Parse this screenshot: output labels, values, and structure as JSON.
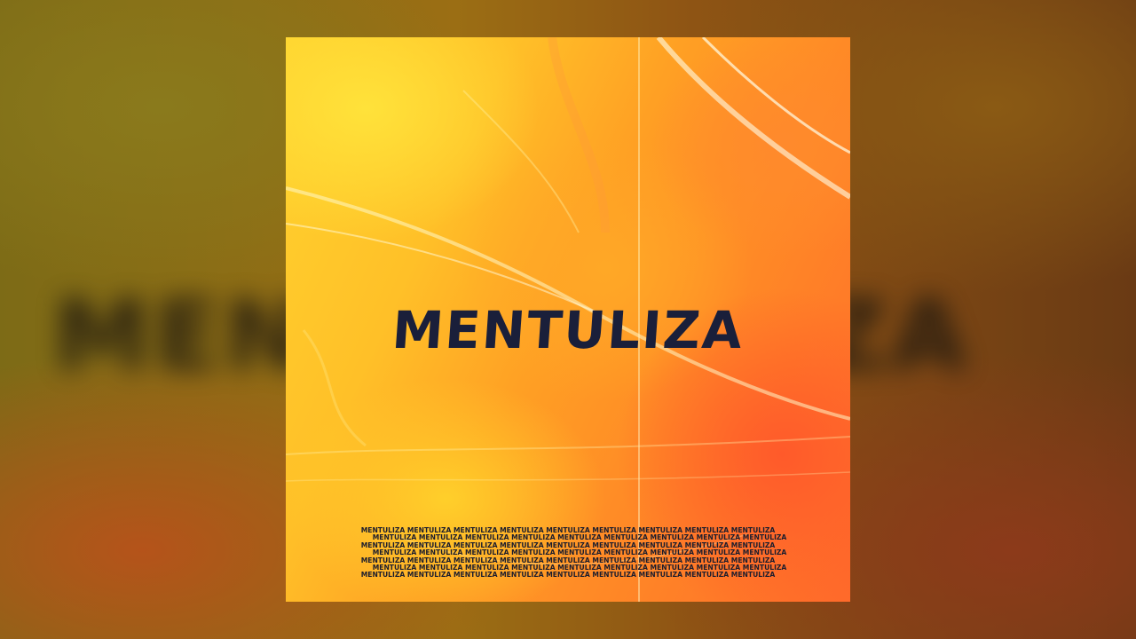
{
  "background": {
    "blurred_word": "MENTULIZA"
  },
  "cover": {
    "title": "MENTULIZA",
    "pattern_text": "MENTULIZA MENTULIZA MENTULIZA MENTULIZA MENTULIZA MENTULIZA MENTULIZA MENTULIZA MENTULIZA",
    "pattern_lines": 7
  },
  "colors": {
    "title": "#1a1f3a",
    "yellow": "#ffd22e",
    "orange": "#ff8a26",
    "red_orange": "#ff5a2a"
  }
}
